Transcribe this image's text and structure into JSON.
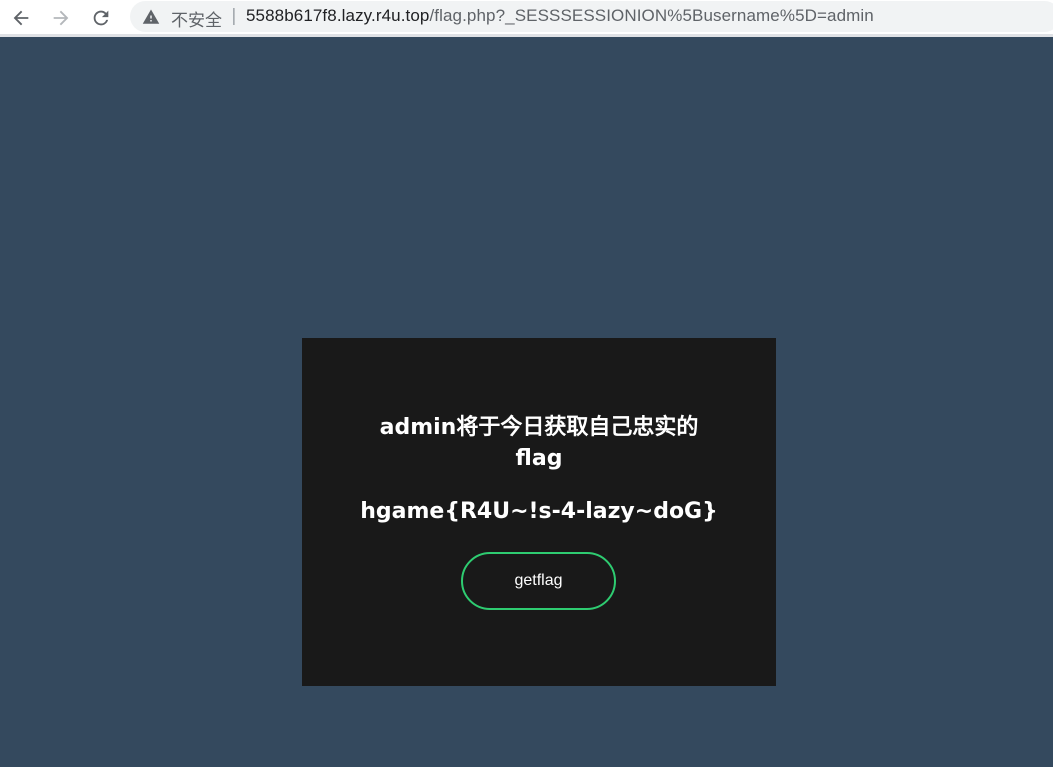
{
  "browser": {
    "security_label": "不安全",
    "separator": "|",
    "url_host": "5588b617f8.lazy.r4u.top",
    "url_path": "/flag.php?_SESSSESSIONION%5Busername%5D=admin"
  },
  "card": {
    "heading": "admin将于今日获取自己忠实的flag",
    "flag": "hgame{R4U~!s-4-lazy~doG}",
    "button_label": "getflag"
  },
  "colors": {
    "page_background": "#34495e",
    "card_background": "#191919",
    "button_border": "#2ecc71"
  },
  "icons": [
    "back-arrow-icon",
    "forward-arrow-icon",
    "reload-icon",
    "warning-icon"
  ]
}
